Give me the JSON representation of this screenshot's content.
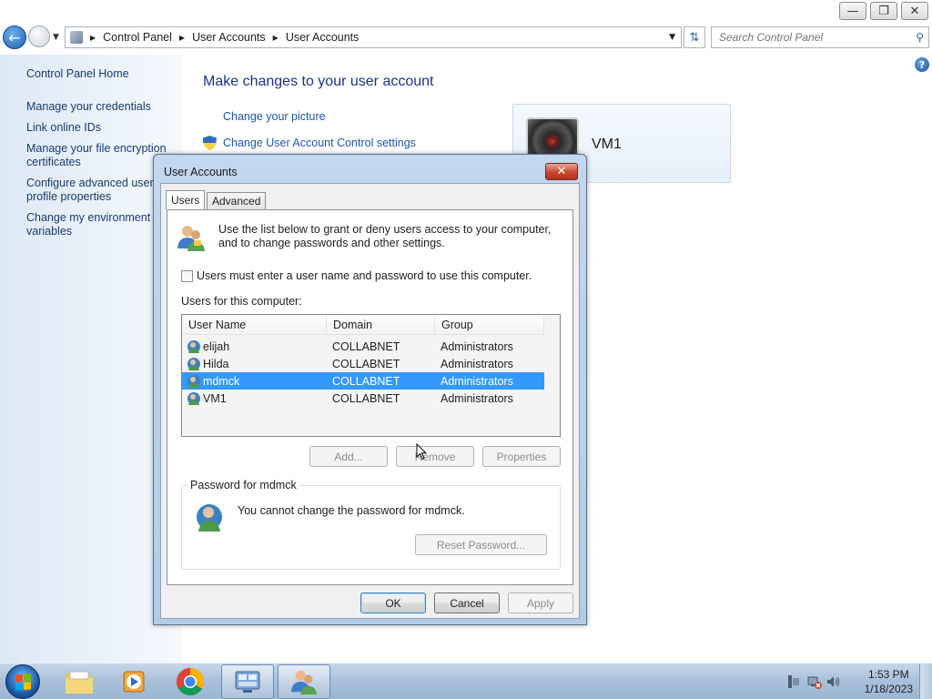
{
  "window": {
    "minimize_glyph": "—",
    "restore_glyph": "❐",
    "close_glyph": "✕"
  },
  "navbar": {
    "breadcrumb": [
      "Control Panel",
      "User Accounts",
      "User Accounts"
    ],
    "search_placeholder": "Search Control Panel"
  },
  "sidebar": {
    "items": [
      {
        "label": "Control Panel Home"
      },
      {
        "label": "Manage your credentials"
      },
      {
        "label": "Link online IDs"
      },
      {
        "label": "Manage your file encryption certificates"
      },
      {
        "label": "Configure advanced user profile properties"
      },
      {
        "label": "Change my environment variables"
      }
    ]
  },
  "main": {
    "title": "Make changes to your user account",
    "links": [
      {
        "label": "Change your picture"
      },
      {
        "label": "Change User Account Control settings"
      }
    ],
    "user_card": {
      "name": "VM1"
    },
    "help_glyph": "?"
  },
  "dialog": {
    "title": "User Accounts",
    "close_glyph": "✕",
    "tabs": [
      {
        "label": "Users",
        "active": true
      },
      {
        "label": "Advanced",
        "active": false
      }
    ],
    "intro_text": "Use the list below to grant or deny users access to your computer, and to change passwords and other settings.",
    "checkbox_label": "Users must enter a user name and password to use this computer.",
    "checkbox_checked": false,
    "list_label": "Users for this computer:",
    "columns": [
      "User Name",
      "Domain",
      "Group"
    ],
    "rows": [
      {
        "name": "elijah",
        "domain": "COLLABNET",
        "group": "Administrators",
        "selected": false
      },
      {
        "name": "Hilda",
        "domain": "COLLABNET",
        "group": "Administrators",
        "selected": false
      },
      {
        "name": "mdmck",
        "domain": "COLLABNET",
        "group": "Administrators",
        "selected": true
      },
      {
        "name": "VM1",
        "domain": "COLLABNET",
        "group": "Administrators",
        "selected": false
      }
    ],
    "list_buttons": {
      "add": "Add...",
      "remove": "Remove",
      "properties": "Properties"
    },
    "password_group": {
      "label": "Password for mdmck",
      "message": "You cannot change the password for mdmck.",
      "reset_button": "Reset Password..."
    },
    "footer": {
      "ok": "OK",
      "cancel": "Cancel",
      "apply": "Apply"
    }
  },
  "taskbar": {
    "clock_time": "1:53 PM",
    "clock_date": "1/18/2023"
  },
  "colors": {
    "selection": "#3399ff",
    "link": "#1f57a6",
    "title": "#1e3287"
  }
}
